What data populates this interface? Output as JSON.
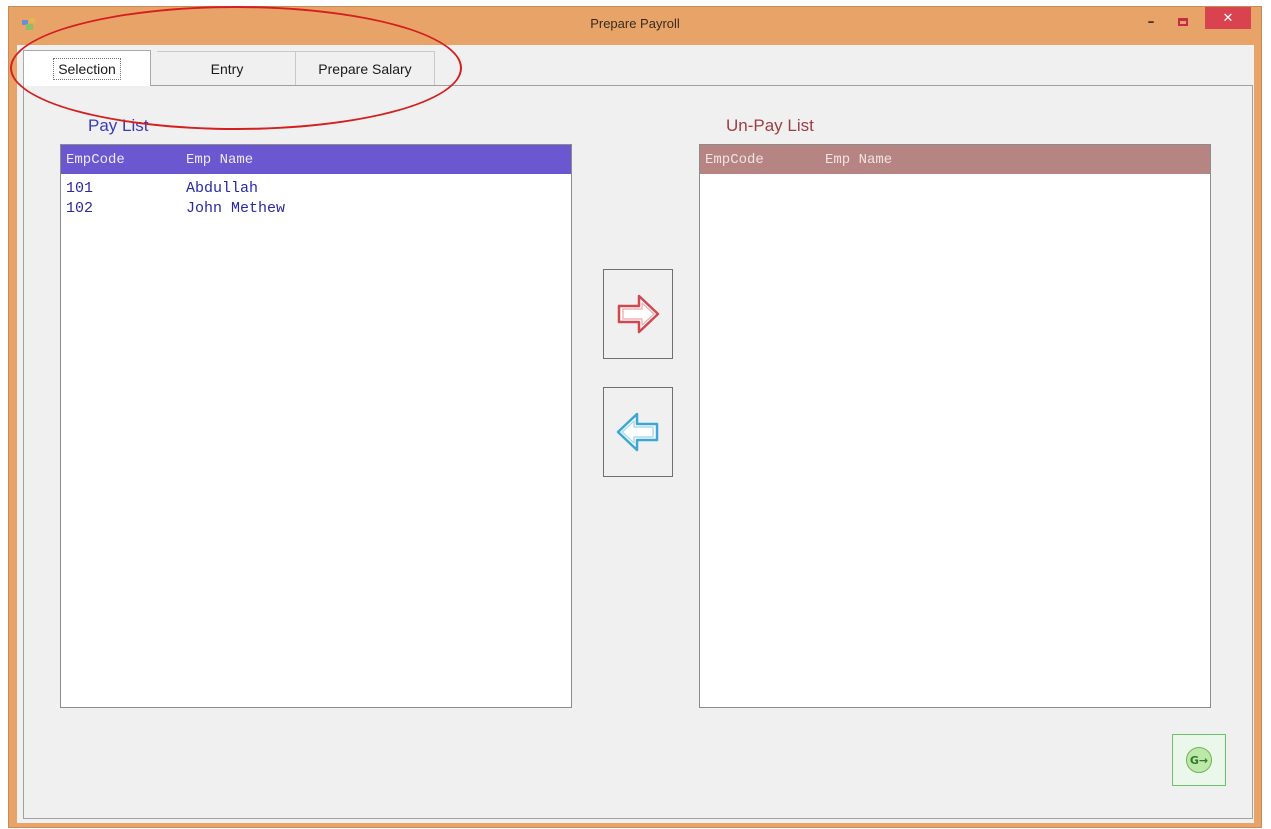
{
  "window": {
    "title": "Prepare Payroll",
    "minimize_label": "–",
    "close_label": "✕",
    "colors": {
      "frame": "#e8a468",
      "close": "#d8434f"
    }
  },
  "tabs": [
    {
      "label": "Selection",
      "active": true
    },
    {
      "label": "Entry",
      "active": false
    },
    {
      "label": "Prepare Salary",
      "active": false
    }
  ],
  "pay_list": {
    "title": "Pay List",
    "columns": [
      "EmpCode",
      "Emp Name"
    ],
    "rows": [
      {
        "code": "101",
        "name": "Abdullah"
      },
      {
        "code": "102",
        "name": "John Methew"
      }
    ],
    "header_color": "#6b57d0"
  },
  "unpay_list": {
    "title": "Un-Pay List",
    "columns": [
      "EmpCode",
      "Emp Name"
    ],
    "rows": [],
    "header_color": "#b68583"
  },
  "buttons": {
    "move_right_icon": "arrow-right-icon",
    "move_left_icon": "arrow-left-icon",
    "exit_label": "G→",
    "exit_icon": "exit-icon"
  }
}
